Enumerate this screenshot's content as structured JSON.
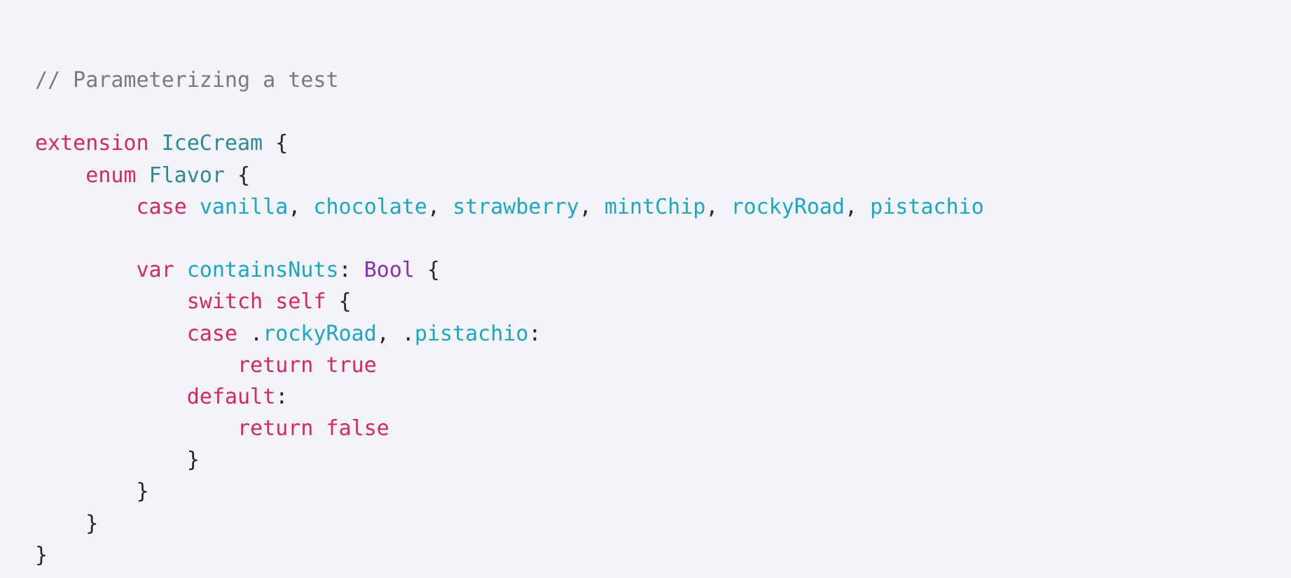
{
  "code_view": {
    "colors": {
      "comment": "#7a7a7a",
      "keyword": "#d3295f",
      "type": "#2a8a9b",
      "ident": "#1aa6c4",
      "builtin": "#8a2fb5",
      "plain": "#262626",
      "background": "#f4f4f8"
    },
    "lines": [
      [
        {
          "t": "comment",
          "s": "// Parameterizing a test"
        }
      ],
      [],
      [
        {
          "t": "keyword",
          "s": "extension"
        },
        {
          "t": "plain",
          "s": " "
        },
        {
          "t": "type",
          "s": "IceCream"
        },
        {
          "t": "plain",
          "s": " {"
        }
      ],
      [
        {
          "t": "plain",
          "s": "    "
        },
        {
          "t": "keyword",
          "s": "enum"
        },
        {
          "t": "plain",
          "s": " "
        },
        {
          "t": "type",
          "s": "Flavor"
        },
        {
          "t": "plain",
          "s": " {"
        }
      ],
      [
        {
          "t": "plain",
          "s": "        "
        },
        {
          "t": "keyword",
          "s": "case"
        },
        {
          "t": "plain",
          "s": " "
        },
        {
          "t": "ident",
          "s": "vanilla"
        },
        {
          "t": "plain",
          "s": ", "
        },
        {
          "t": "ident",
          "s": "chocolate"
        },
        {
          "t": "plain",
          "s": ", "
        },
        {
          "t": "ident",
          "s": "strawberry"
        },
        {
          "t": "plain",
          "s": ", "
        },
        {
          "t": "ident",
          "s": "mintChip"
        },
        {
          "t": "plain",
          "s": ", "
        },
        {
          "t": "ident",
          "s": "rockyRoad"
        },
        {
          "t": "plain",
          "s": ", "
        },
        {
          "t": "ident",
          "s": "pistachio"
        }
      ],
      [],
      [
        {
          "t": "plain",
          "s": "        "
        },
        {
          "t": "keyword",
          "s": "var"
        },
        {
          "t": "plain",
          "s": " "
        },
        {
          "t": "ident",
          "s": "containsNuts"
        },
        {
          "t": "plain",
          "s": ": "
        },
        {
          "t": "builtin",
          "s": "Bool"
        },
        {
          "t": "plain",
          "s": " {"
        }
      ],
      [
        {
          "t": "plain",
          "s": "            "
        },
        {
          "t": "keyword",
          "s": "switch"
        },
        {
          "t": "plain",
          "s": " "
        },
        {
          "t": "keyword",
          "s": "self"
        },
        {
          "t": "plain",
          "s": " {"
        }
      ],
      [
        {
          "t": "plain",
          "s": "            "
        },
        {
          "t": "keyword",
          "s": "case"
        },
        {
          "t": "plain",
          "s": " ."
        },
        {
          "t": "ident",
          "s": "rockyRoad"
        },
        {
          "t": "plain",
          "s": ", ."
        },
        {
          "t": "ident",
          "s": "pistachio"
        },
        {
          "t": "plain",
          "s": ":"
        }
      ],
      [
        {
          "t": "plain",
          "s": "                "
        },
        {
          "t": "keyword",
          "s": "return"
        },
        {
          "t": "plain",
          "s": " "
        },
        {
          "t": "keyword",
          "s": "true"
        }
      ],
      [
        {
          "t": "plain",
          "s": "            "
        },
        {
          "t": "keyword",
          "s": "default"
        },
        {
          "t": "plain",
          "s": ":"
        }
      ],
      [
        {
          "t": "plain",
          "s": "                "
        },
        {
          "t": "keyword",
          "s": "return"
        },
        {
          "t": "plain",
          "s": " "
        },
        {
          "t": "keyword",
          "s": "false"
        }
      ],
      [
        {
          "t": "plain",
          "s": "            }"
        }
      ],
      [
        {
          "t": "plain",
          "s": "        }"
        }
      ],
      [
        {
          "t": "plain",
          "s": "    }"
        }
      ],
      [
        {
          "t": "plain",
          "s": "}"
        }
      ]
    ]
  }
}
